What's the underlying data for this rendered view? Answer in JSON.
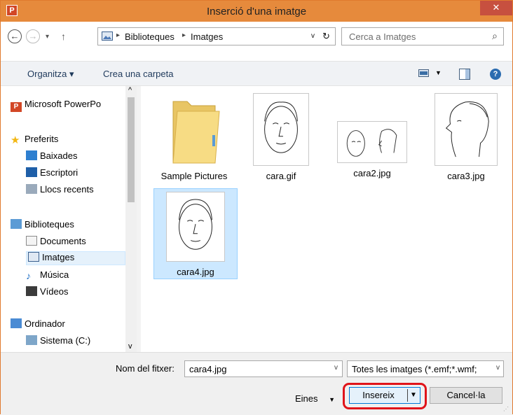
{
  "window": {
    "title": "Inserció d'una imatge",
    "app_icon_letter": "P",
    "close_glyph": "✕"
  },
  "nav": {
    "back_glyph": "←",
    "forward_glyph": "→",
    "recent_glyph": "▾",
    "up_glyph": "↑",
    "breadcrumb": [
      "Biblioteques",
      "Imatges"
    ],
    "refresh_glyph": "↻",
    "dropdown_glyph": "v",
    "search_placeholder": "Cerca a Imatges",
    "search_glyph": "⌕"
  },
  "toolbar": {
    "organize_label": "Organitza ▾",
    "new_folder_label": "Crea una carpeta",
    "help_glyph": "?"
  },
  "sidebar": {
    "items": [
      {
        "label": "Microsoft PowerPo",
        "icon": "powerpoint-icon"
      },
      {
        "label": "Preferits",
        "icon": "star-icon"
      },
      {
        "label": "Baixades",
        "icon": "downloads-icon"
      },
      {
        "label": "Escriptori",
        "icon": "desktop-icon"
      },
      {
        "label": "Llocs recents",
        "icon": "recent-places-icon"
      },
      {
        "label": "Biblioteques",
        "icon": "libraries-icon"
      },
      {
        "label": "Documents",
        "icon": "documents-icon"
      },
      {
        "label": "Imatges",
        "icon": "pictures-icon"
      },
      {
        "label": "Música",
        "icon": "music-icon"
      },
      {
        "label": "Vídeos",
        "icon": "videos-icon"
      },
      {
        "label": "Ordinador",
        "icon": "computer-icon"
      },
      {
        "label": "Sistema (C:)",
        "icon": "drive-icon"
      }
    ],
    "scroll_up": "^",
    "scroll_down": "v"
  },
  "files": [
    {
      "name": "Sample Pictures",
      "kind": "folder"
    },
    {
      "name": "cara.gif",
      "kind": "image"
    },
    {
      "name": "cara2.jpg",
      "kind": "image"
    },
    {
      "name": "cara3.jpg",
      "kind": "image"
    },
    {
      "name": "cara4.jpg",
      "kind": "image"
    }
  ],
  "bottom": {
    "filename_label": "Nom del fitxer:",
    "filename_value": "cara4.jpg",
    "filetype_value": "Totes les imatges (*.emf;*.wmf;",
    "tools_label": "Eines",
    "insert_label": "Insereix",
    "cancel_label": "Cancel·la"
  },
  "colors": {
    "titlebar": "#e68a3c",
    "close": "#c7503f",
    "highlight": "#e0141a",
    "selection": "#cce8ff"
  }
}
